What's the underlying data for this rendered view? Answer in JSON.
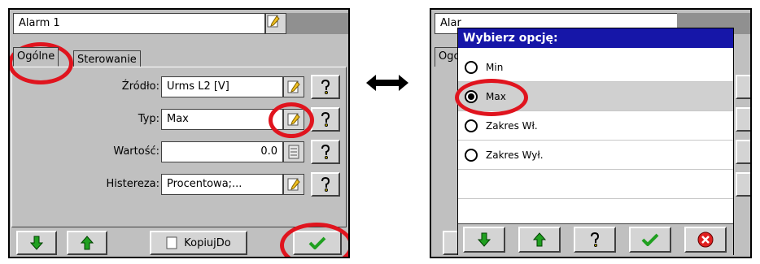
{
  "left": {
    "title": "Alarm 1",
    "tabs": [
      "Ogólne",
      "Sterowanie"
    ],
    "rows": [
      {
        "label": "Źródło:",
        "value": "Urms L2 [V]"
      },
      {
        "label": "Typ:",
        "value": "Max"
      },
      {
        "label": "Wartość:",
        "value": "0.0"
      },
      {
        "label": "Histereza:",
        "value": "Procentowa;..."
      }
    ],
    "copy_label": "KopiujDo"
  },
  "right": {
    "title_partial": "Alar",
    "tab_partial": "Ogo",
    "dialog_title": "Wybierz opcję:",
    "options": [
      "Min",
      "Max",
      "Zakres Wł.",
      "Zakres Wył."
    ],
    "selected_index": 1
  },
  "arrow": "⟷",
  "icons": {
    "edit": "pencil-icon",
    "help": "help-icon",
    "calc": "calculator-icon",
    "down": "arrow-down-icon",
    "up": "arrow-up-icon",
    "ok": "checkmark-icon",
    "cancel": "cancel-icon"
  },
  "colors": {
    "callout": "#e0141e",
    "dialog_title": "#1616a8",
    "screen": "#c0c0c0",
    "selected_row": "#d0d0d0"
  }
}
